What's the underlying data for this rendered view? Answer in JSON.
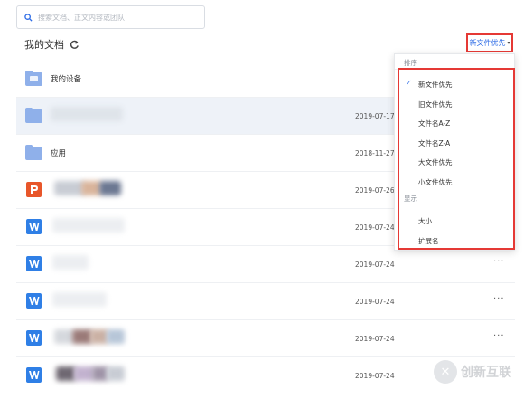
{
  "search": {
    "placeholder": "搜索文档、正文内容或团队"
  },
  "header": {
    "title": "我的文档",
    "sort_label": "新文件优先"
  },
  "colors": {
    "accent": "#2f6de6",
    "highlight": "#e53935",
    "folder": "#8fb0ea",
    "ppt": "#e8562a",
    "word": "#2f7fe6"
  },
  "files": [
    {
      "type": "folder",
      "name": "我的设备",
      "date": "",
      "more": ""
    },
    {
      "type": "folder",
      "name": "",
      "date": "2019-07-17",
      "more": ""
    },
    {
      "type": "folder",
      "name": "应用",
      "date": "2018-11-27",
      "more": ""
    },
    {
      "type": "ppt",
      "name": "",
      "date": "2019-07-26",
      "more": ""
    },
    {
      "type": "word",
      "name": "",
      "date": "2019-07-24",
      "more": ""
    },
    {
      "type": "word",
      "name": "",
      "date": "2019-07-24",
      "more": "···"
    },
    {
      "type": "word",
      "name": "",
      "date": "2019-07-24",
      "more": "···"
    },
    {
      "type": "word",
      "name": "",
      "date": "2019-07-24",
      "more": "···"
    },
    {
      "type": "word",
      "name": "",
      "date": "2019-07-24",
      "more": "···"
    }
  ],
  "dropdown": {
    "sort_group": "排序",
    "sort_items": [
      "新文件优先",
      "旧文件优先",
      "文件名A-Z",
      "文件名Z-A",
      "大文件优先",
      "小文件优先"
    ],
    "selected_sort": "新文件优先",
    "display_group": "显示",
    "display_items": [
      "大小",
      "扩展名"
    ]
  },
  "watermark": {
    "logo": "✕",
    "text": "创新互联"
  }
}
